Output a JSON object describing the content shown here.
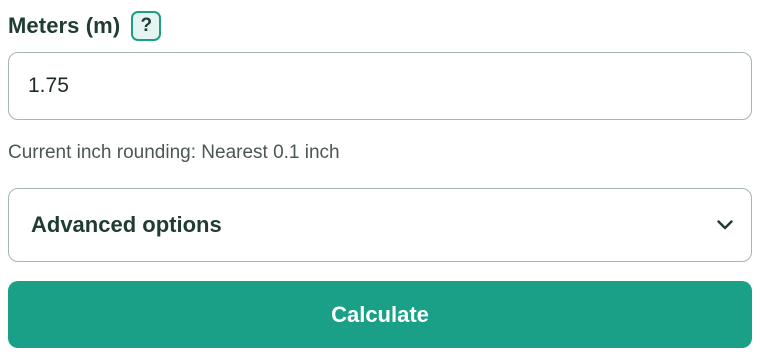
{
  "length_field": {
    "label": "Meters (m)",
    "help_label": "?",
    "value": "1.75"
  },
  "rounding_note": "Current inch rounding: Nearest 0.1 inch",
  "advanced": {
    "title": "Advanced options",
    "icon": "chevron-down-icon",
    "expanded": false
  },
  "calculate_label": "Calculate",
  "colors": {
    "accent": "#19a086",
    "label_text": "#1f3b33",
    "border": "#a6b6b0",
    "help_bg": "#e6f4f1"
  }
}
